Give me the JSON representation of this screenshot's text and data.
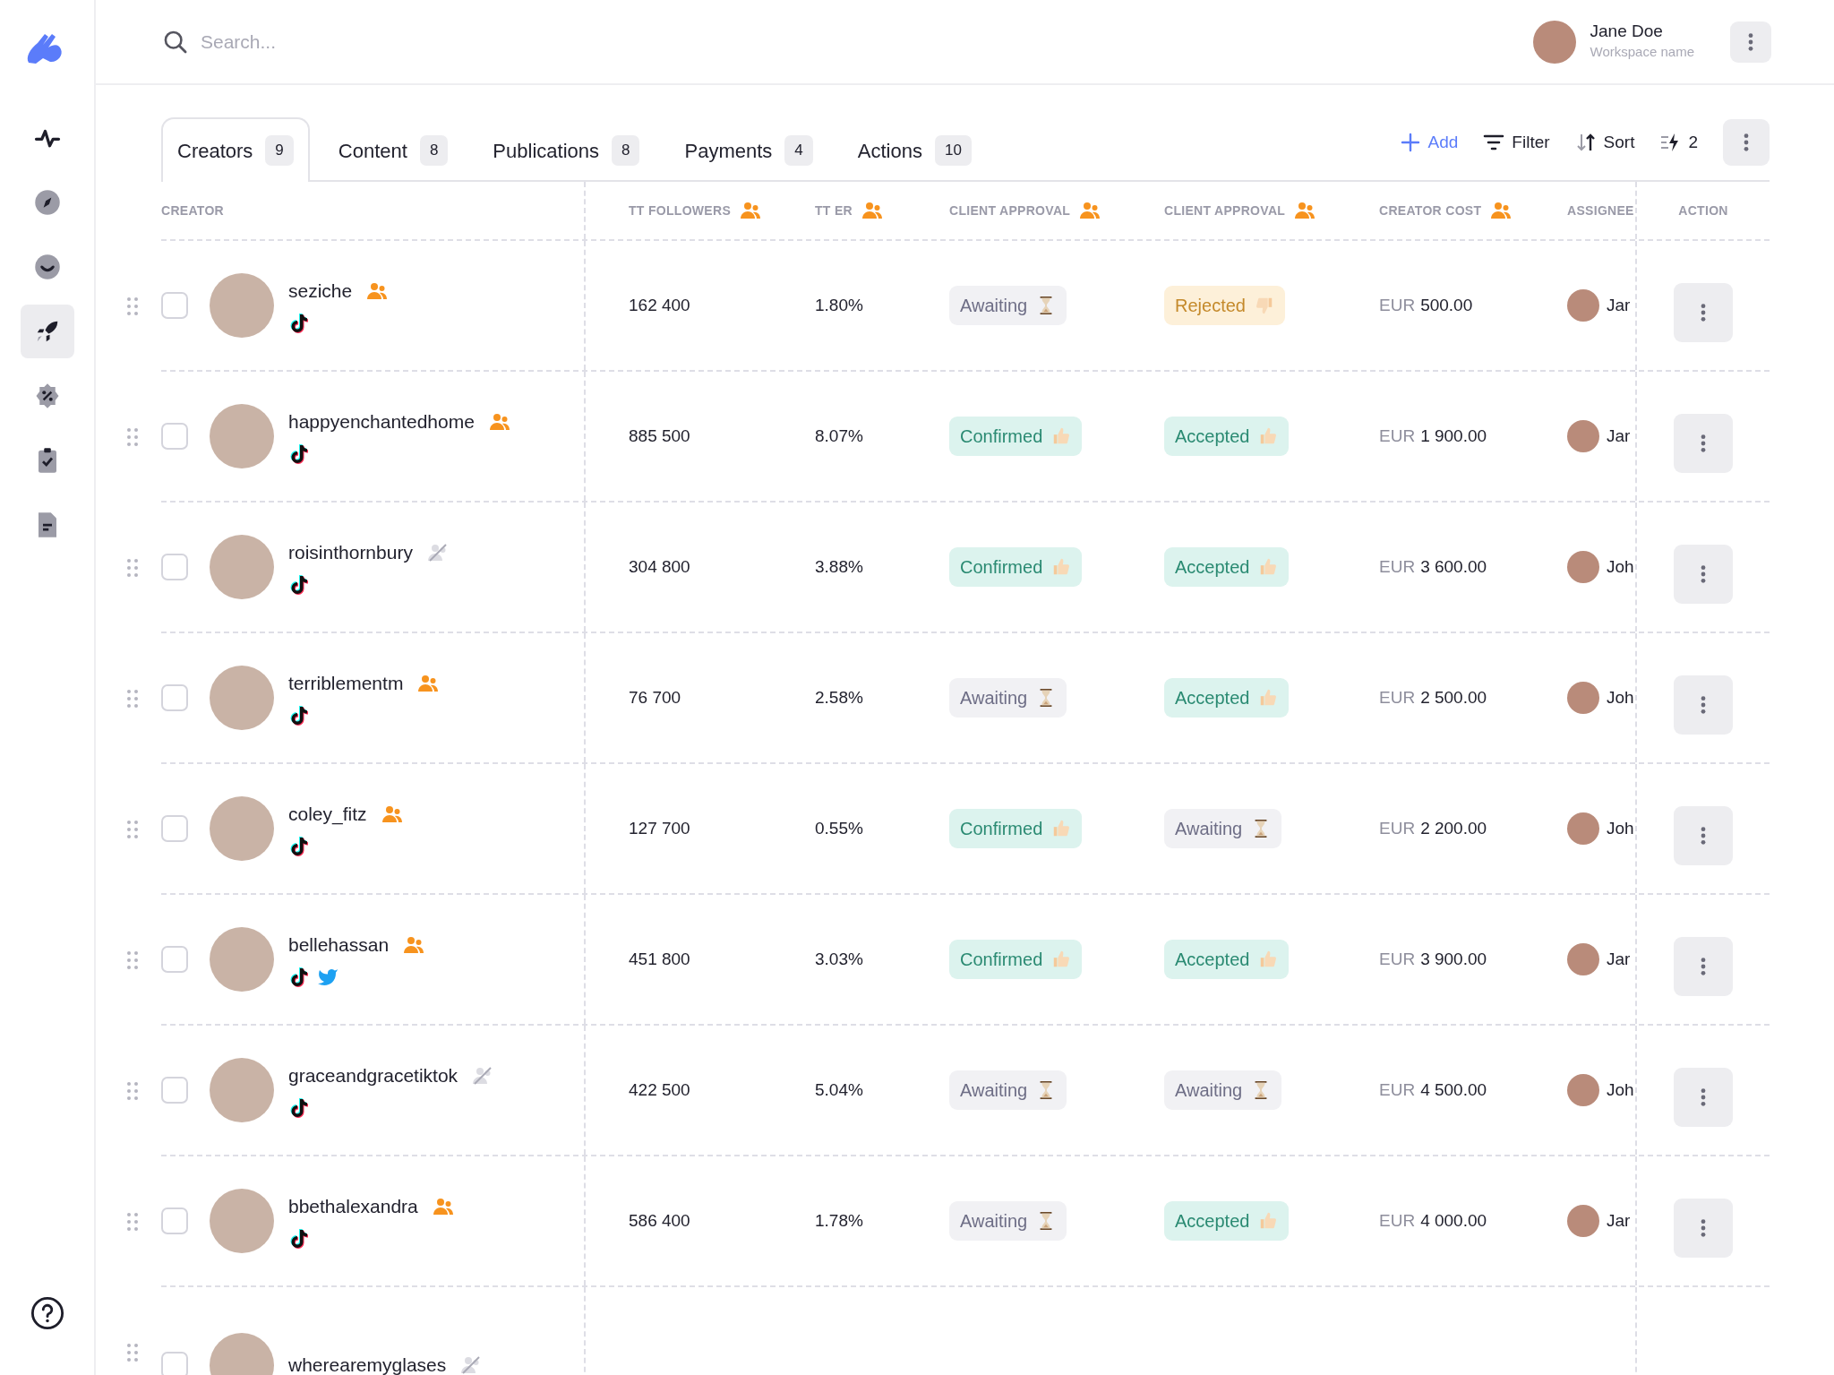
{
  "sidebar": {
    "items": [
      {
        "kind": "pulse",
        "selected": false
      },
      {
        "kind": "compass",
        "selected": false
      },
      {
        "kind": "smile",
        "selected": false
      },
      {
        "kind": "rocket",
        "selected": true
      },
      {
        "kind": "discount",
        "selected": false
      },
      {
        "kind": "clipboard",
        "selected": false
      },
      {
        "kind": "document",
        "selected": false
      }
    ]
  },
  "search": {
    "placeholder": "Search..."
  },
  "user": {
    "name": "Jane Doe",
    "workspace": "Workspace name"
  },
  "tabs": [
    {
      "label": "Creators",
      "count": "9",
      "selected": true
    },
    {
      "label": "Content",
      "count": "8",
      "selected": false
    },
    {
      "label": "Publications",
      "count": "8",
      "selected": false
    },
    {
      "label": "Payments",
      "count": "4",
      "selected": false
    },
    {
      "label": "Actions",
      "count": "10",
      "selected": false
    }
  ],
  "toolbar": [
    {
      "kind": "add",
      "label": "Add"
    },
    {
      "kind": "filter",
      "label": "Filter"
    },
    {
      "kind": "sort",
      "label": "Sort"
    },
    {
      "kind": "bolt",
      "label": "2"
    }
  ],
  "table": {
    "columns": [
      {
        "label": "CREATOR"
      },
      {
        "label": "TT FOLLOWERS",
        "icon": true
      },
      {
        "label": "TT ER",
        "icon": true
      },
      {
        "label": "CLIENT APPROVAL",
        "icon": true
      },
      {
        "label": "CLIENT APPROVAL",
        "icon": true
      },
      {
        "label": "CREATOR COST",
        "icon": true
      },
      {
        "label": "ASSIGNEE"
      },
      {
        "label": "ACTION"
      }
    ],
    "rows": [
      {
        "name": "seziche",
        "managed": true,
        "platforms": [
          {
            "kind": "tiktok"
          }
        ],
        "checked": false,
        "followers": "162 400",
        "er": "1.80%",
        "approval": {
          "label": "Awaiting",
          "kind": "awaiting"
        },
        "approval_2": {
          "label": "Rejected",
          "kind": "rejected"
        },
        "currency": "EUR",
        "cost": "500.00",
        "assignee": "Jar"
      },
      {
        "name": "happyenchantedhome",
        "managed": true,
        "platforms": [
          {
            "kind": "tiktok"
          }
        ],
        "checked": false,
        "followers": "885 500",
        "er": "8.07%",
        "approval": {
          "label": "Confirmed",
          "kind": "confirmed"
        },
        "approval_2": {
          "label": "Accepted",
          "kind": "accepted"
        },
        "currency": "EUR",
        "cost": "1 900.00",
        "assignee": "Jar"
      },
      {
        "name": "roisinthornbury",
        "managed": false,
        "platforms": [
          {
            "kind": "tiktok"
          }
        ],
        "checked": false,
        "followers": "304 800",
        "er": "3.88%",
        "approval": {
          "label": "Confirmed",
          "kind": "confirmed"
        },
        "approval_2": {
          "label": "Accepted",
          "kind": "accepted"
        },
        "currency": "EUR",
        "cost": "3 600.00",
        "assignee": "Joh"
      },
      {
        "name": "terriblementm",
        "managed": true,
        "platforms": [
          {
            "kind": "tiktok"
          }
        ],
        "checked": false,
        "followers": "76 700",
        "er": "2.58%",
        "approval": {
          "label": "Awaiting",
          "kind": "awaiting"
        },
        "approval_2": {
          "label": "Accepted",
          "kind": "accepted"
        },
        "currency": "EUR",
        "cost": "2 500.00",
        "assignee": "Joh"
      },
      {
        "name": "coley_fitz",
        "managed": true,
        "platforms": [
          {
            "kind": "tiktok"
          }
        ],
        "checked": false,
        "followers": "127 700",
        "er": "0.55%",
        "approval": {
          "label": "Confirmed",
          "kind": "confirmed"
        },
        "approval_2": {
          "label": "Awaiting",
          "kind": "awaiting"
        },
        "currency": "EUR",
        "cost": "2 200.00",
        "assignee": "Joh"
      },
      {
        "name": "bellehassan",
        "managed": true,
        "platforms": [
          {
            "kind": "tiktok"
          },
          {
            "kind": "twitter"
          }
        ],
        "checked": false,
        "followers": "451 800",
        "er": "3.03%",
        "approval": {
          "label": "Confirmed",
          "kind": "confirmed"
        },
        "approval_2": {
          "label": "Accepted",
          "kind": "accepted"
        },
        "currency": "EUR",
        "cost": "3 900.00",
        "assignee": "Jar"
      },
      {
        "name": "graceandgracetiktok",
        "managed": false,
        "platforms": [
          {
            "kind": "tiktok"
          }
        ],
        "checked": false,
        "followers": "422 500",
        "er": "5.04%",
        "approval": {
          "label": "Awaiting",
          "kind": "awaiting"
        },
        "approval_2": {
          "label": "Awaiting",
          "kind": "awaiting"
        },
        "currency": "EUR",
        "cost": "4 500.00",
        "assignee": "Joh"
      },
      {
        "name": "bbethalexandra",
        "managed": true,
        "platforms": [
          {
            "kind": "tiktok"
          }
        ],
        "checked": false,
        "followers": "586 400",
        "er": "1.78%",
        "approval": {
          "label": "Awaiting",
          "kind": "awaiting"
        },
        "approval_2": {
          "label": "Accepted",
          "kind": "accepted"
        },
        "currency": "EUR",
        "cost": "4 000.00",
        "assignee": "Jar"
      },
      {
        "name": "wherearemyglases",
        "managed": false,
        "checked": false
      }
    ]
  }
}
